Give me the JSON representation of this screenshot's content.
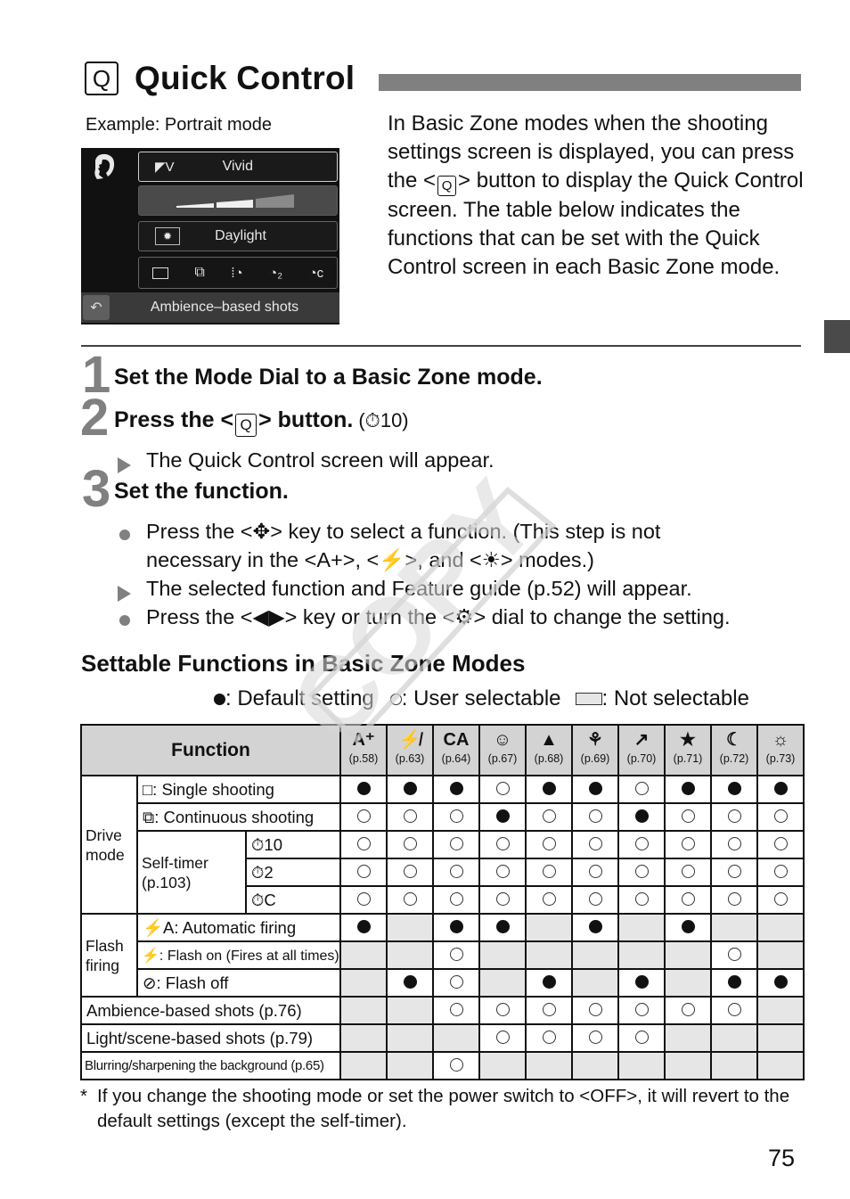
{
  "header": {
    "title_icon": "Q",
    "title": "Quick Control"
  },
  "example": {
    "label": "Example: Portrait mode",
    "screen": {
      "mode_icon": "portrait-icon",
      "picture_style_icon": "◤V",
      "picture_style": "Vivid",
      "brightness_level": "2 of 3",
      "white_balance_icon": "daylight-icon",
      "white_balance": "Daylight",
      "drive_icons": [
        "single-shooting-icon",
        "continuous-shooting-icon",
        "self-timer-10s-icon",
        "self-timer-2s-icon",
        "self-timer-continuous-icon"
      ],
      "back_icon": "↶",
      "bottom_label": "Ambience–based shots"
    }
  },
  "intro": {
    "before": "In Basic Zone modes when the shooting settings screen is displayed, you can press the <",
    "button": "Q",
    "after": "> button to display the Quick Control screen. The table below indicates the functions that can be set with the Quick Control screen in each Basic Zone mode."
  },
  "steps": [
    {
      "number": "1",
      "title": "Set the Mode Dial to a Basic Zone mode."
    },
    {
      "number": "2",
      "title_before": "Press the <",
      "title_button": "Q",
      "title_after": "> button.",
      "ref": "(⏱10)"
    },
    {
      "number": "3",
      "title": "Set the function."
    }
  ],
  "step2_result": "The Quick Control screen will appear.",
  "step3_bullets": {
    "b1_line1": "Press the <✥> key to select a function. (This step is not",
    "b1_line2": "necessary in the <A+>, <⚡>, and <☀> modes.)",
    "b2": "The selected function and Feature guide (p.52) will appear.",
    "b3": "Press the <◀▶> key or turn the <⚙> dial to change the setting."
  },
  "section": {
    "title": "Settable Functions in Basic Zone Modes",
    "legend": {
      "default": ": Default setting",
      "user": ": User selectable",
      "not": ": Not selectable"
    }
  },
  "table": {
    "function_header": "Function",
    "modes": [
      {
        "icon": "A⁺",
        "name": "scene-intelligent-auto",
        "page": "(p.58)"
      },
      {
        "icon": "⚡̸",
        "name": "flash-off",
        "page": "(p.63)"
      },
      {
        "icon": "CA",
        "name": "creative-auto",
        "page": "(p.64)"
      },
      {
        "icon": "☺",
        "name": "portrait",
        "page": "(p.67)"
      },
      {
        "icon": "▲",
        "name": "landscape",
        "page": "(p.68)"
      },
      {
        "icon": "⚘",
        "name": "close-up",
        "page": "(p.69)"
      },
      {
        "icon": "↗",
        "name": "sports",
        "page": "(p.70)"
      },
      {
        "icon": "★",
        "name": "night-portrait",
        "page": "(p.71)"
      },
      {
        "icon": "☾",
        "name": "food",
        "page": "(p.72)"
      },
      {
        "icon": "☼",
        "name": "candlelight",
        "page": "(p.73)"
      }
    ],
    "groups": {
      "drive": "Drive mode",
      "self_timer": "Self-timer (p.103)",
      "flash": "Flash firing"
    },
    "rows": [
      {
        "label": "□: Single shooting",
        "values": [
          "F",
          "F",
          "F",
          "O",
          "F",
          "F",
          "O",
          "F",
          "F",
          "F"
        ]
      },
      {
        "label": "⧉: Continuous shooting",
        "values": [
          "O",
          "O",
          "O",
          "F",
          "O",
          "O",
          "F",
          "O",
          "O",
          "O"
        ]
      },
      {
        "label": "⏱10",
        "values": [
          "O",
          "O",
          "O",
          "O",
          "O",
          "O",
          "O",
          "O",
          "O",
          "O"
        ]
      },
      {
        "label": "⏱2",
        "values": [
          "O",
          "O",
          "O",
          "O",
          "O",
          "O",
          "O",
          "O",
          "O",
          "O"
        ]
      },
      {
        "label": "⏱C",
        "values": [
          "O",
          "O",
          "O",
          "O",
          "O",
          "O",
          "O",
          "O",
          "O",
          "O"
        ]
      },
      {
        "label": "⚡A:  Automatic firing",
        "values": [
          "F",
          "-",
          "F",
          "F",
          "-",
          "F",
          "-",
          "F",
          "-",
          "-"
        ]
      },
      {
        "label": "⚡: Flash on (Fires at all times)",
        "values": [
          "-",
          "-",
          "O",
          "-",
          "-",
          "-",
          "-",
          "-",
          "O",
          "-"
        ]
      },
      {
        "label": "⊘: Flash off",
        "values": [
          "-",
          "F",
          "O",
          "-",
          "F",
          "-",
          "F",
          "-",
          "F",
          "F"
        ]
      },
      {
        "label": "Ambience-based shots (p.76)",
        "values": [
          "-",
          "-",
          "O",
          "O",
          "O",
          "O",
          "O",
          "O",
          "O",
          "-"
        ]
      },
      {
        "label": "Light/scene-based shots (p.79)",
        "values": [
          "-",
          "-",
          "-",
          "O",
          "O",
          "O",
          "O",
          "-",
          "-",
          "-"
        ]
      },
      {
        "label": "Blurring/sharpening the background (p.65)",
        "values": [
          "-",
          "-",
          "O",
          "-",
          "-",
          "-",
          "-",
          "-",
          "-",
          "-"
        ]
      }
    ]
  },
  "footnote": {
    "marker": "*",
    "text": "If you change the shooting mode or set the power switch to <OFF>, it will revert to the default settings (except the self-timer)."
  },
  "page_number": "75",
  "watermark": "COPY",
  "colors": {
    "title_bar": "#808080",
    "step_number": "#808080",
    "header_fill": "#d3d3d3",
    "not_selectable": "#e6e6e6",
    "side_tab": "#4a4a4a"
  }
}
